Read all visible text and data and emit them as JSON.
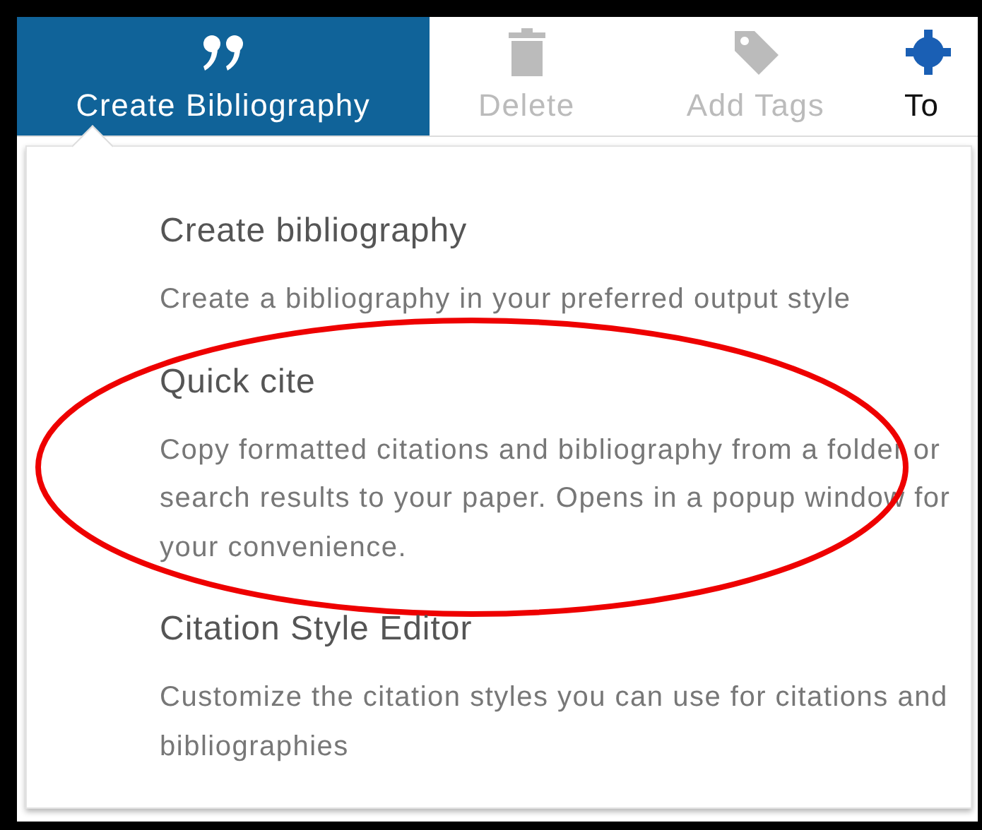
{
  "toolbar": [
    {
      "label": "Create Bibliography",
      "kind": "quote",
      "selected": true,
      "disabled": false
    },
    {
      "label": "Delete",
      "kind": "trash",
      "selected": false,
      "disabled": true
    },
    {
      "label": "Add Tags",
      "kind": "tag",
      "selected": false,
      "disabled": true
    },
    {
      "label": "To",
      "kind": "gear",
      "selected": false,
      "disabled": false
    }
  ],
  "menu": {
    "items": [
      {
        "title": "Create bibliography",
        "description": "Create a bibliography in your preferred output style",
        "highlighted": false
      },
      {
        "title": "Quick cite",
        "description": "Copy formatted citations and bibliography from a folder or search results to your paper. Opens in a popup window for your convenience.",
        "highlighted": true
      },
      {
        "title": "Citation Style Editor",
        "description": "Customize the citation styles you can use for citations and bibliographies",
        "highlighted": false
      }
    ]
  }
}
